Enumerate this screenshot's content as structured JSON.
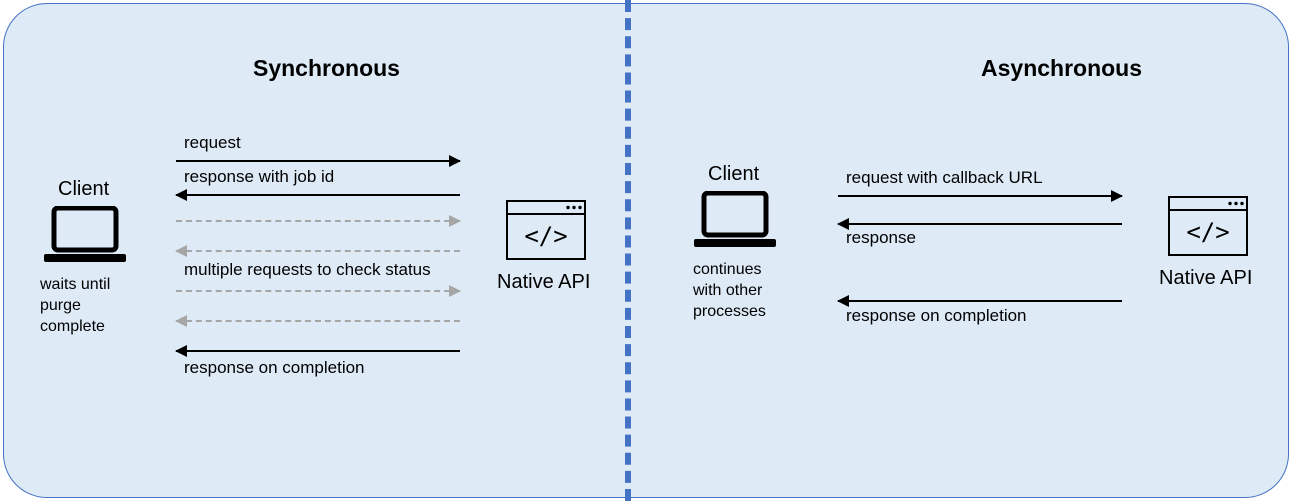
{
  "left": {
    "title": "Synchronous",
    "client_label": "Client",
    "client_sub": "waits until\npurge\ncomplete",
    "api_label": "Native API",
    "flows": {
      "request": "request",
      "response_jobid": "response with job id",
      "multi_check": "multiple requests to check status",
      "response_done": "response on completion"
    }
  },
  "right": {
    "title": "Asynchronous",
    "client_label": "Client",
    "client_sub": "continues\nwith other\nprocesses",
    "api_label": "Native API",
    "flows": {
      "request_cb": "request with callback URL",
      "response": "response",
      "response_done": "response on completion"
    }
  }
}
